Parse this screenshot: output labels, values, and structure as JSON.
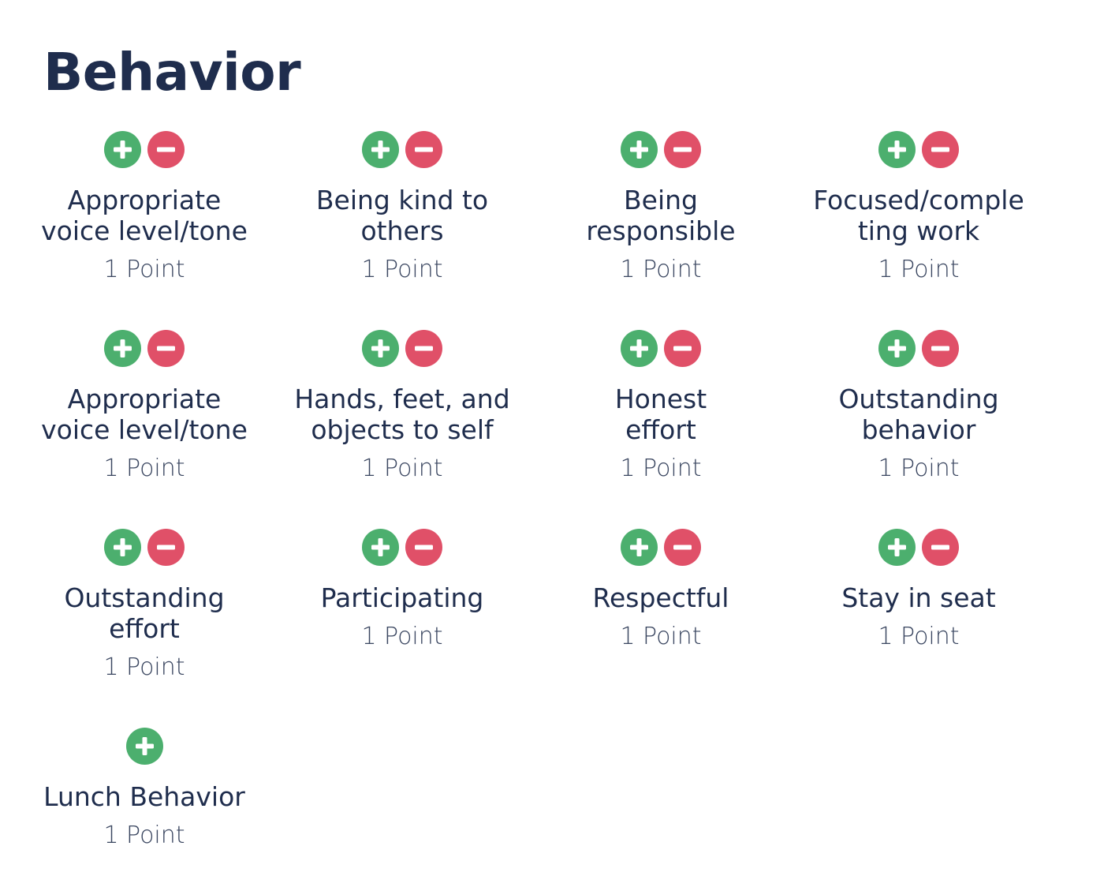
{
  "page": {
    "title": "Behavior"
  },
  "colors": {
    "title": "#1f2d4d",
    "plus": "#4caf6e",
    "minus": "#e05068"
  },
  "icons": {
    "plus": "plus-circle-icon",
    "minus": "minus-circle-icon"
  },
  "behaviors": [
    {
      "label_line1": "Appropriate",
      "label_line2": "voice level/tone",
      "points": "1 Point",
      "has_minus": true
    },
    {
      "label_line1": "Being kind to",
      "label_line2": "others",
      "points": "1 Point",
      "has_minus": true
    },
    {
      "label_line1": "Being",
      "label_line2": "responsible",
      "points": "1 Point",
      "has_minus": true
    },
    {
      "label_line1": "Focused/comple",
      "label_line2": "ting work",
      "points": "1 Point",
      "has_minus": true
    },
    {
      "label_line1": "Appropriate",
      "label_line2": "voice level/tone",
      "points": "1 Point",
      "has_minus": true
    },
    {
      "label_line1": "Hands, feet, and",
      "label_line2": "objects to self",
      "points": "1 Point",
      "has_minus": true
    },
    {
      "label_line1": "Honest",
      "label_line2": "effort",
      "points": "1 Point",
      "has_minus": true
    },
    {
      "label_line1": "Outstanding",
      "label_line2": "behavior",
      "points": "1 Point",
      "has_minus": true
    },
    {
      "label_line1": "Outstanding",
      "label_line2": "effort",
      "points": "1 Point",
      "has_minus": true
    },
    {
      "label_line1": "Participating",
      "label_line2": "",
      "points": "1 Point",
      "has_minus": true
    },
    {
      "label_line1": "Respectful",
      "label_line2": "",
      "points": "1 Point",
      "has_minus": true
    },
    {
      "label_line1": "Stay in seat",
      "label_line2": "",
      "points": "1 Point",
      "has_minus": true
    },
    {
      "label_line1": "Lunch Behavior",
      "label_line2": "",
      "points": "1 Point",
      "has_minus": false
    }
  ]
}
